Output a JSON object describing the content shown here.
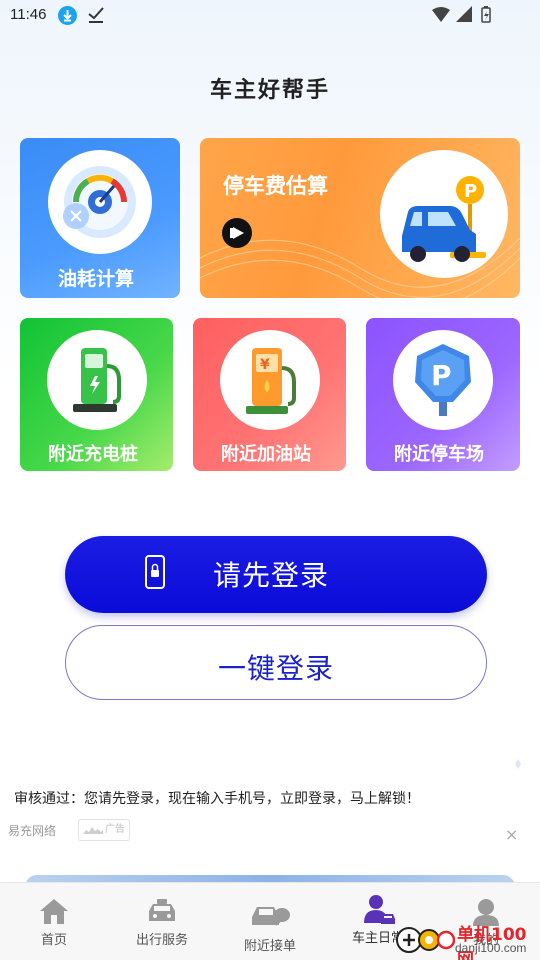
{
  "status_bar": {
    "time": "11:46"
  },
  "app": {
    "title": "车主好帮手"
  },
  "features": {
    "fuel": {
      "label": "油耗计算",
      "icon": "fuel-gauge-icon"
    },
    "parking_fee": {
      "label": "停车费估算",
      "icon": "car-parking-icon"
    },
    "charge": {
      "label": "附近充电桩",
      "icon": "charging-pile-icon"
    },
    "gas": {
      "label": "附近加油站",
      "icon": "gas-pump-icon"
    },
    "lot": {
      "label": "附近停车场",
      "icon": "parking-sign-icon"
    }
  },
  "buttons": {
    "login": "请先登录",
    "one_key_login": "一键登录"
  },
  "notice": {
    "text": "审核通过：您请先登录，现在输入手机号，立即登录，马上解锁！"
  },
  "ad": {
    "source": "易充网络",
    "badge": "广告",
    "close": "×"
  },
  "tabbar": {
    "items": [
      {
        "label": "首页",
        "icon": "home-icon"
      },
      {
        "label": "出行服务",
        "icon": "taxi-icon"
      },
      {
        "label": "附近接单",
        "icon": "car-chat-icon"
      },
      {
        "label": "车主日常",
        "icon": "driver-icon"
      },
      {
        "label": "我的",
        "icon": "profile-icon"
      }
    ]
  },
  "watermark": {
    "name": "单机100网",
    "url": "danji100.com"
  },
  "colors": {
    "login_button": "#0a0bd8",
    "one_key_text": "#1a22c8",
    "fuel_card": "#3a8cf6",
    "parking_card": "#ffa54a",
    "charge_card": "#10c335",
    "gas_card": "#ff5f5f",
    "lot_card": "#8c53ff"
  }
}
